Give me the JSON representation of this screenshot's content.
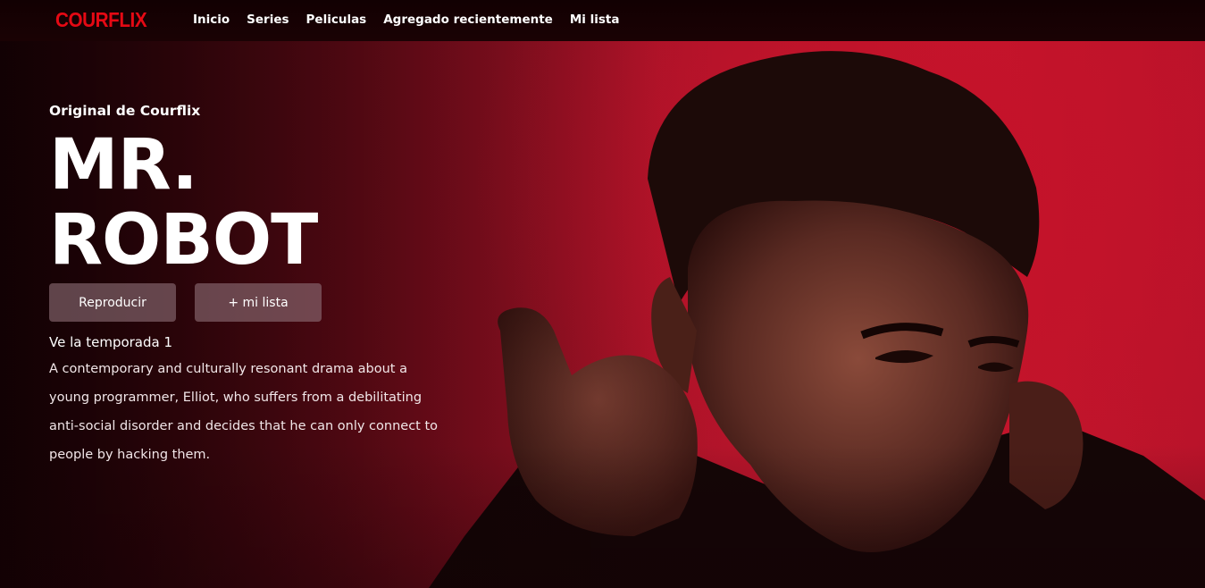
{
  "brand": {
    "logo_text": "COURFLIX",
    "accent_color": "#e50914"
  },
  "nav": {
    "items": [
      {
        "label": "Inicio"
      },
      {
        "label": "Series"
      },
      {
        "label": "Peliculas"
      },
      {
        "label": "Agregado recientemente"
      },
      {
        "label": "Mi lista"
      }
    ]
  },
  "hero": {
    "eyebrow": "Original de Courflix",
    "title_line1": "MR.",
    "title_line2": "ROBOT",
    "play_button": "Reproducir",
    "list_button": "+ mi lista",
    "season_text": "Ve la temporada 1",
    "description": "A contemporary and culturally resonant drama about a young programmer, Elliot, who suffers from a debilitating anti-social disorder and decides that he can only connect to people by hacking them.",
    "background_color": "#c4122a"
  }
}
